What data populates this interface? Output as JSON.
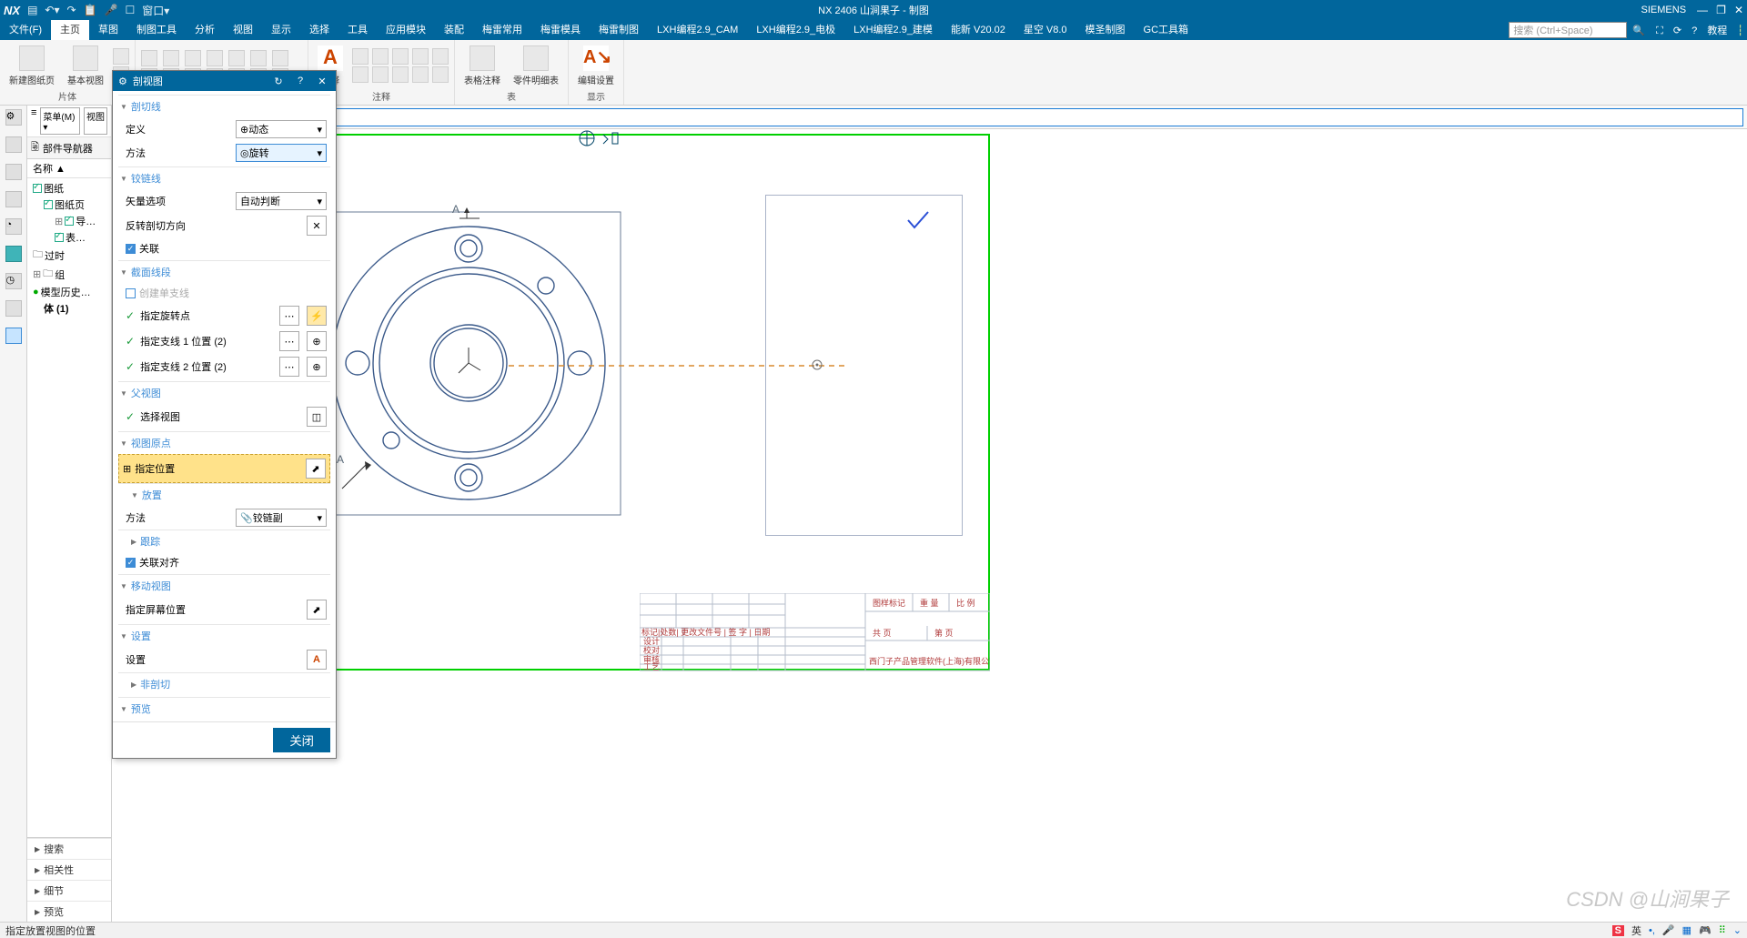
{
  "app": {
    "logo": "NX",
    "title": "NX 2406 山涧果子 - 制图",
    "brand": "SIEMENS"
  },
  "qat_icons": [
    "save",
    "undo",
    "redo",
    "sep",
    "cut",
    "mic",
    "sep",
    "touch",
    "window",
    "sep",
    "screen"
  ],
  "qat_window_label": "窗口▾",
  "winctrl": [
    "minimize",
    "restore",
    "close"
  ],
  "menus": [
    "文件(F)",
    "主页",
    "草图",
    "制图工具",
    "分析",
    "视图",
    "显示",
    "选择",
    "工具",
    "应用模块",
    "装配",
    "梅雷常用",
    "梅雷模具",
    "梅雷制图",
    "LXH编程2.9_CAM",
    "LXH编程2.9_电极",
    "LXH编程2.9_建模",
    "能新 V20.02",
    "星空 V8.0",
    "模圣制图",
    "GC工具箱"
  ],
  "active_menu": 1,
  "search_ph": "搜索 (Ctrl+Space)",
  "help_label": "教程",
  "ribbon": {
    "groups": [
      {
        "label": "片体",
        "big": [
          {
            "icon": "new-sheet",
            "label": "新建图纸页"
          },
          {
            "icon": "base-view",
            "label": "基本视图"
          }
        ],
        "extra_small": 2
      },
      {
        "label": "",
        "small_rows": 2,
        "small_cols": 7
      },
      {
        "label": "注释",
        "big": [
          {
            "icon": "annotate",
            "label": "注释"
          }
        ],
        "small_rows": 2,
        "small_cols": 5
      },
      {
        "label": "表",
        "big": [
          {
            "icon": "table-note",
            "label": "表格注释"
          },
          {
            "icon": "parts-list",
            "label": "零件明细表"
          }
        ]
      },
      {
        "label": "显示",
        "big": [
          {
            "icon": "edit-settings",
            "label": "编辑设置"
          }
        ]
      }
    ]
  },
  "navpanel": {
    "menu_label": "菜单(M) ▾",
    "view_label": "视图",
    "title_icon": "part-navigator",
    "title": "部件导航器",
    "col_header": "名称 ▲",
    "tree": [
      {
        "t": "图纸",
        "chk": true,
        "depth": 0
      },
      {
        "t": "图纸页",
        "chk": true,
        "depth": 1,
        "cut": true
      },
      {
        "t": "导…",
        "chk": true,
        "depth": 2,
        "plus": true
      },
      {
        "t": "表…",
        "chk": true,
        "depth": 2
      },
      {
        "t": "过时",
        "chk": false,
        "depth": 0,
        "folder": true
      },
      {
        "t": "组",
        "chk": false,
        "depth": 0,
        "plus": true,
        "folder": true
      },
      {
        "t": "模型历史…",
        "chk": false,
        "depth": 0,
        "green": true
      },
      {
        "t": "体 (1)",
        "chk": false,
        "depth": 1,
        "bold": true
      }
    ],
    "accordion": [
      "搜索",
      "相关性",
      "细节",
      "预览"
    ]
  },
  "dialog": {
    "title": "剖视图",
    "sections": {
      "cutline": "剖切线",
      "def_lbl": "定义",
      "def_val": "动态",
      "method_lbl": "方法",
      "method_val": "旋转",
      "hinge": "铰链线",
      "vec_lbl": "矢量选项",
      "vec_val": "自动判断",
      "reverse_lbl": "反转剖切方向",
      "assoc_lbl": "关联",
      "seg": "截面线段",
      "create_single": "创建单支线",
      "spec_pivot": "指定旋转点",
      "spec_l1": "指定支线 1 位置 (2)",
      "spec_l2": "指定支线 2 位置 (2)",
      "parent": "父视图",
      "sel_view": "选择视图",
      "origin": "视图原点",
      "spec_pos": "指定位置",
      "place": "放置",
      "place_method_lbl": "方法",
      "place_method_val": "铰链副",
      "track": "跟踪",
      "align": "关联对齐",
      "move": "移动视图",
      "spec_screen": "指定屏幕位置",
      "settings": "设置",
      "settings_row": "设置",
      "nonsec": "非剖切",
      "preview": "预览"
    },
    "close_btn": "关闭"
  },
  "status": {
    "prompt": "指定放置视图的位置",
    "ime": "英"
  },
  "canvas": {
    "label_a1": "A",
    "label_a2": "A",
    "titleblock_text": "西门子产品管理软件(上海)有限公司",
    "tb_hdr": [
      "图样标记",
      "重 量",
      "比 例"
    ],
    "tb_row": [
      "标记|处数| 更改文件号 | 签 字 | 日期"
    ],
    "tb_left": [
      "设计",
      "校对",
      "审核",
      "工艺"
    ],
    "tb_right": [
      "共  页",
      "第  页"
    ]
  },
  "watermark": "CSDN @山涧果子"
}
